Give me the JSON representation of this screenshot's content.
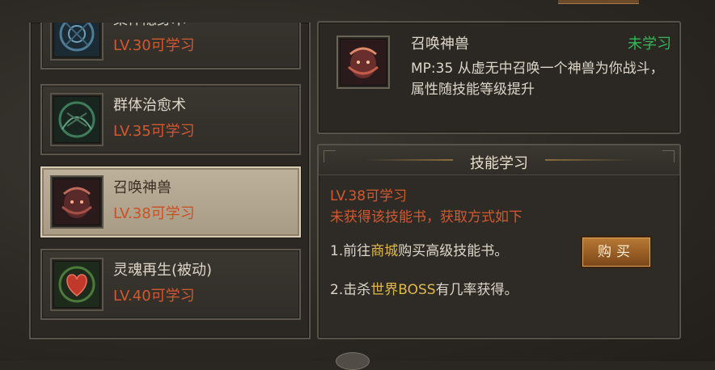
{
  "skills": [
    {
      "name": "集体隐身术",
      "level": "LV.30可学习"
    },
    {
      "name": "群体治愈术",
      "level": "LV.35可学习"
    },
    {
      "name": "召唤神兽",
      "level": "LV.38可学习"
    },
    {
      "name": "灵魂再生(被动)",
      "level": "LV.40可学习"
    }
  ],
  "detail": {
    "name": "召唤神兽",
    "status": "未学习",
    "description": "MP:35  从虚无中召唤一个神兽为你战斗，属性随技能等级提升"
  },
  "learn": {
    "title": "技能学习",
    "level": "LV.38可学习",
    "note": "未获得该技能书，获取方式如下",
    "step1_prefix": "1.前往",
    "step1_highlight": "商城",
    "step1_suffix": "购买高级技能书。",
    "step2_prefix": "2.击杀",
    "step2_highlight": "世界BOSS",
    "step2_suffix": "有几率获得。",
    "buy_label": "购买"
  },
  "colors": {
    "status_green": "#35b556",
    "level_orange": "#d4582e",
    "highlight_gold": "#e0b84a"
  },
  "icons": [
    "stealth-skill-icon",
    "group-heal-skill-icon",
    "summon-beast-skill-icon",
    "soul-regen-skill-icon"
  ]
}
